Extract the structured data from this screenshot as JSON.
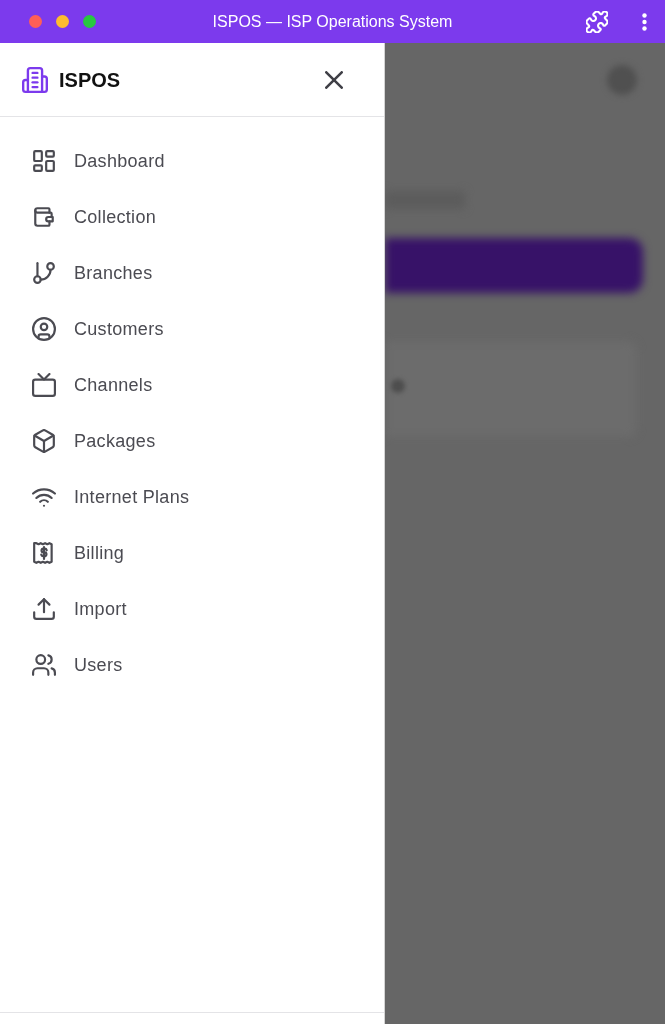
{
  "window": {
    "title": "ISPOS — ISP Operations System"
  },
  "sidebar": {
    "brand": "ISPOS",
    "items": [
      {
        "label": "Dashboard",
        "selected": false
      },
      {
        "label": "Collection",
        "selected": false
      },
      {
        "label": "Branches",
        "selected": false
      },
      {
        "label": "Customers",
        "selected": false
      },
      {
        "label": "Channels",
        "selected": false
      },
      {
        "label": "Packages",
        "selected": false
      },
      {
        "label": "Internet Plans",
        "selected": false
      },
      {
        "label": "Billing",
        "selected": false
      },
      {
        "label": "Import",
        "selected": false
      },
      {
        "label": "Users",
        "selected": false
      }
    ]
  }
}
